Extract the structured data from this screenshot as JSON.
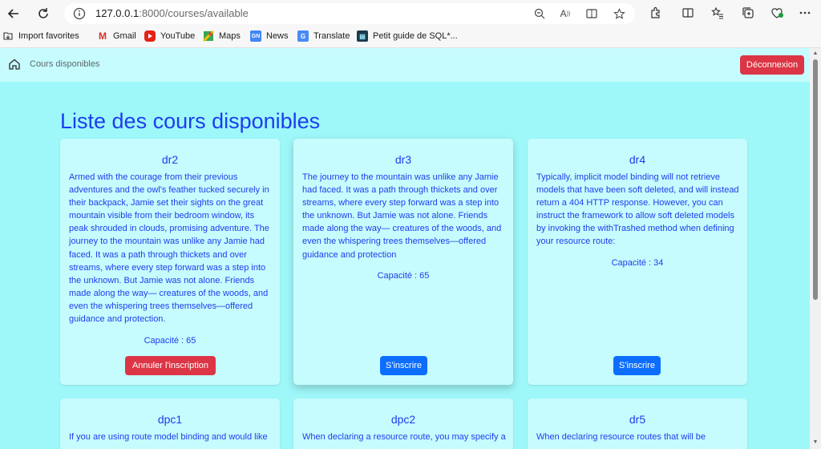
{
  "browser": {
    "url_host": "127.0.0.1",
    "url_rest": ":8000/courses/available",
    "bookmarks": [
      "Import favorites",
      "Gmail",
      "YouTube",
      "Maps",
      "News",
      "Translate",
      "Petit guide de SQL*..."
    ]
  },
  "header": {
    "breadcrumb": "Cours disponibles",
    "logout_label": "Déconnexion"
  },
  "page": {
    "title": "Liste des cours disponibles"
  },
  "courses": [
    {
      "name": "dr2",
      "description": "Armed with the courage from their previous adventures and the owl's feather tucked securely in their backpack, Jamie set their sights on the great mountain visible from their bedroom window, its peak shrouded in clouds, promising adventure. The journey to the mountain was unlike any Jamie had faced. It was a path through thickets and over streams, where every step forward was a step into the unknown. But Jamie was not alone. Friends made along the way— creatures of the woods, and even the whispering trees themselves—offered guidance and protection.",
      "capacity": "Capacité : 65",
      "action": "Annuler l'inscription"
    },
    {
      "name": "dr3",
      "description": "The journey to the mountain was unlike any Jamie had faced. It was a path through thickets and over streams, where every step forward was a step into the unknown. But Jamie was not alone. Friends made along the way— creatures of the woods, and even the whispering trees themselves—offered guidance and protection",
      "capacity": "Capacité : 65",
      "action": "S'inscrire"
    },
    {
      "name": "dr4",
      "description": "Typically, implicit model binding will not retrieve models that have been soft deleted, and will instead return a 404 HTTP response. However, you can instruct the framework to allow soft deleted models by invoking the withTrashed method when defining your resource route:",
      "capacity": "Capacité : 34",
      "action": "S'inscrire"
    },
    {
      "name": "dpc1",
      "description": "If you are using route model binding and would like"
    },
    {
      "name": "dpc2",
      "description": "When declaring a resource route, you may specify a"
    },
    {
      "name": "dr5",
      "description": "When declaring resource routes that will be"
    }
  ]
}
